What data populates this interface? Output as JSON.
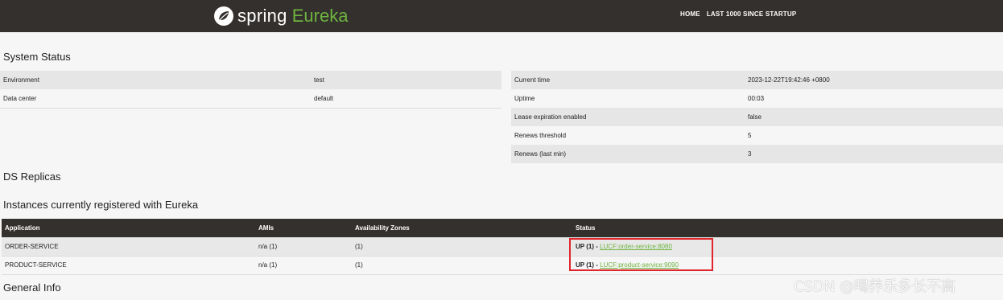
{
  "header": {
    "brand_spring": "spring",
    "brand_eureka": "Eureka",
    "nav": [
      {
        "label": "HOME"
      },
      {
        "label": "LAST 1000 SINCE STARTUP"
      }
    ]
  },
  "system_status": {
    "title": "System Status",
    "left": [
      {
        "key": "Environment",
        "value": "test"
      },
      {
        "key": "Data center",
        "value": "default"
      }
    ],
    "right": [
      {
        "key": "Current time",
        "value": "2023-12-22T19:42:46 +0800"
      },
      {
        "key": "Uptime",
        "value": "00:03"
      },
      {
        "key": "Lease expiration enabled",
        "value": "false"
      },
      {
        "key": "Renews threshold",
        "value": "5"
      },
      {
        "key": "Renews (last min)",
        "value": "3"
      }
    ]
  },
  "ds_replicas": {
    "title": "DS Replicas"
  },
  "instances": {
    "title": "Instances currently registered with Eureka",
    "headers": [
      "Application",
      "AMIs",
      "Availability Zones",
      "Status"
    ],
    "rows": [
      {
        "application": "ORDER-SERVICE",
        "amis": "n/a (1)",
        "zones": "(1)",
        "status": "UP (1) - ",
        "link": "LUCF:order-service:8080"
      },
      {
        "application": "PRODUCT-SERVICE",
        "amis": "n/a (1)",
        "zones": "(1)",
        "status": "UP (1) - ",
        "link": "LUCF:product-service:9090"
      }
    ]
  },
  "general_info": {
    "title": "General Info"
  },
  "watermark": "CSDN @喝养乐多长不高",
  "colors": {
    "topbar": "#34302d",
    "brand_green": "#6db33f",
    "highlight_red": "#e0262c"
  }
}
